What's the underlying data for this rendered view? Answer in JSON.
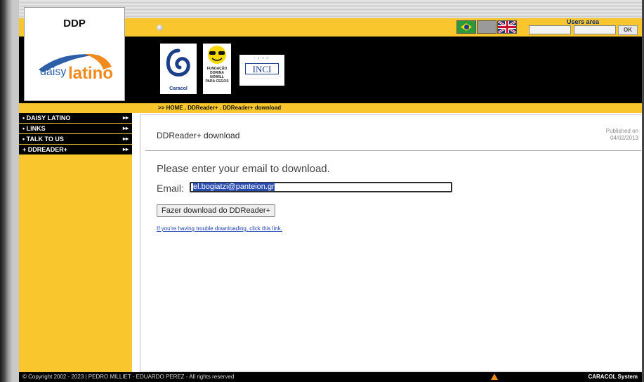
{
  "header": {
    "logo_title": "DDP",
    "logo_daisy": "daisy",
    "logo_latino": "latino",
    "languages": [
      "Português",
      "Español",
      "English"
    ],
    "users_area_label": "Users area",
    "ok_label": "OK"
  },
  "partners": {
    "caracol": "Caracol",
    "dorina_lines": [
      "FUNDAÇÃO",
      "DORINA",
      "NOWILL",
      "PARA CEGOS"
    ],
    "inci": "INCI"
  },
  "breadcrumb": ">> HOME . DDReader+ . DDReader+ download",
  "sidebar": {
    "items": [
      {
        "bullet": "•",
        "label": "DAISY LATINO",
        "arrow": "▸▸"
      },
      {
        "bullet": "•",
        "label": "LINKS",
        "arrow": "▸▸"
      },
      {
        "bullet": "•",
        "label": "TALK TO US",
        "arrow": "▸▸"
      },
      {
        "bullet": "+",
        "label": "DDREADER+",
        "arrow": "▸▸"
      }
    ]
  },
  "content": {
    "title": "DDReader+ download",
    "published_label": "Published on",
    "published_date": "04/02/2013",
    "prompt": "Please enter your email to download.",
    "email_label": "Email:",
    "email_value": "el.bogiatzi@panteion.gr",
    "download_button": "Fazer download do DDReader+",
    "trouble_link": "If you're having trouble downloading, click this link."
  },
  "footer": {
    "copyright": "© Copyright 2002 - 2023 | PEDRO MILLIET - EDUARDO PEREZ - All rights reserved",
    "system": "CARACOL System"
  },
  "colors": {
    "accent_yellow": "#f9c62e",
    "header_black": "#000000",
    "link_blue": "#1a3eb0"
  }
}
